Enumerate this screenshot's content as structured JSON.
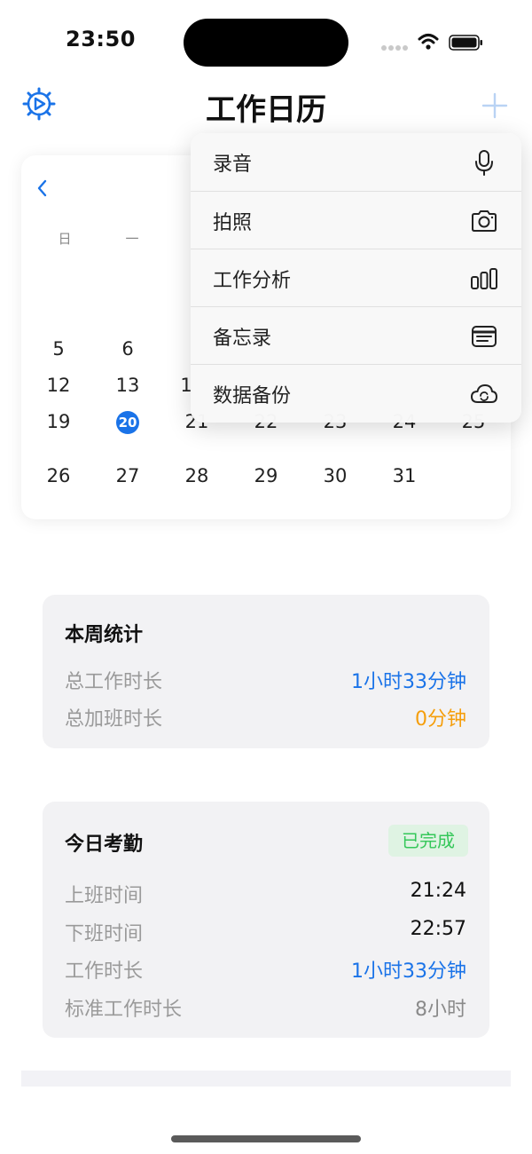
{
  "status_bar": {
    "time": "23:50"
  },
  "header": {
    "title": "工作日历"
  },
  "calendar": {
    "weekdays": [
      "日",
      "一"
    ],
    "days": [
      "5",
      "6",
      "12",
      "13",
      "1",
      "19",
      "20",
      "21",
      "22",
      "23",
      "24",
      "25",
      "26",
      "27",
      "28",
      "29",
      "30",
      "31"
    ]
  },
  "menu": {
    "items": [
      {
        "label": "录音",
        "icon": "microphone-icon"
      },
      {
        "label": "拍照",
        "icon": "camera-icon"
      },
      {
        "label": "工作分析",
        "icon": "bar-chart-icon"
      },
      {
        "label": "备忘录",
        "icon": "memo-icon"
      },
      {
        "label": "数据备份",
        "icon": "cloud-sync-icon"
      }
    ]
  },
  "week_stats": {
    "title": "本周统计",
    "rows": [
      {
        "label": "总工作时长",
        "value": "1小时33分钟"
      },
      {
        "label": "总加班时长",
        "value": "0分钟"
      }
    ]
  },
  "today_attendance": {
    "title": "今日考勤",
    "badge": "已完成",
    "rows": [
      {
        "label": "上班时间",
        "value": "21:24"
      },
      {
        "label": "下班时间",
        "value": "22:57"
      },
      {
        "label": "工作时长",
        "value": "1小时33分钟"
      },
      {
        "label": "标准工作时长",
        "value": "8小时"
      }
    ]
  },
  "colors": {
    "accent": "#1a73e8",
    "overtime": "#f59e0b",
    "success": "#34c759"
  }
}
